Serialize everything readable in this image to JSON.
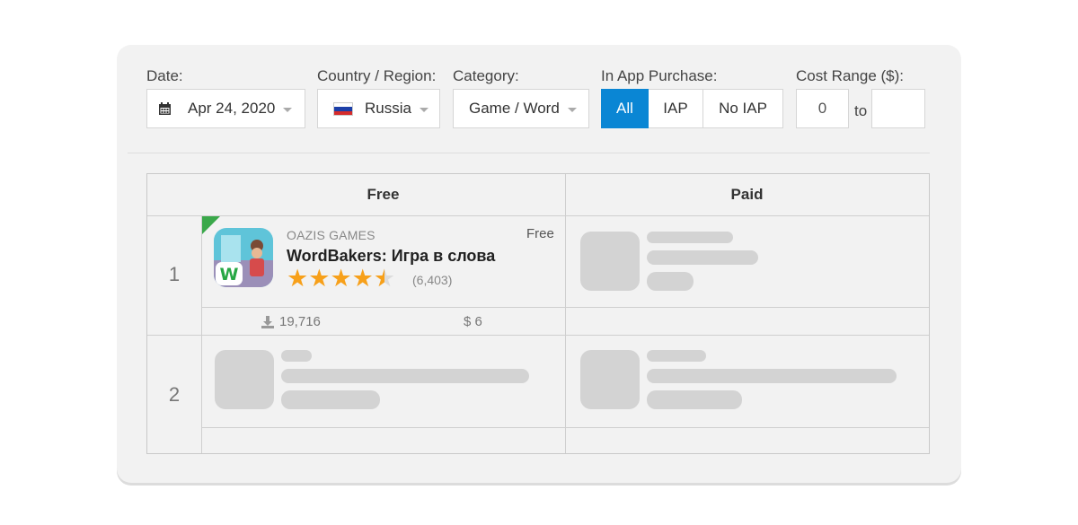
{
  "filters": {
    "date": {
      "label": "Date:",
      "value": "Apr 24, 2020"
    },
    "country": {
      "label": "Country / Region:",
      "value": "Russia"
    },
    "category": {
      "label": "Category:",
      "value": "Game / Word"
    },
    "iap": {
      "label": "In App Purchase:",
      "options": [
        "All",
        "IAP",
        "No IAP"
      ],
      "selected": "All"
    },
    "cost": {
      "label": "Cost Range ($):",
      "min": "0",
      "to": "to",
      "max": ""
    }
  },
  "table": {
    "columns": [
      "Free",
      "Paid"
    ],
    "rows": [
      {
        "rank": "1",
        "free": {
          "developer": "OAZIS GAMES",
          "price": "Free",
          "title": "WordBakers: Игра в слова",
          "rating": 4.5,
          "rating_count": "(6,403)",
          "downloads": "19,716",
          "revenue": "$ 6"
        }
      },
      {
        "rank": "2"
      }
    ]
  },
  "colors": {
    "accent": "#0a86d4",
    "star": "#f7a01a",
    "placeholder": "#d3d3d3",
    "new_badge": "#3aa84a"
  }
}
